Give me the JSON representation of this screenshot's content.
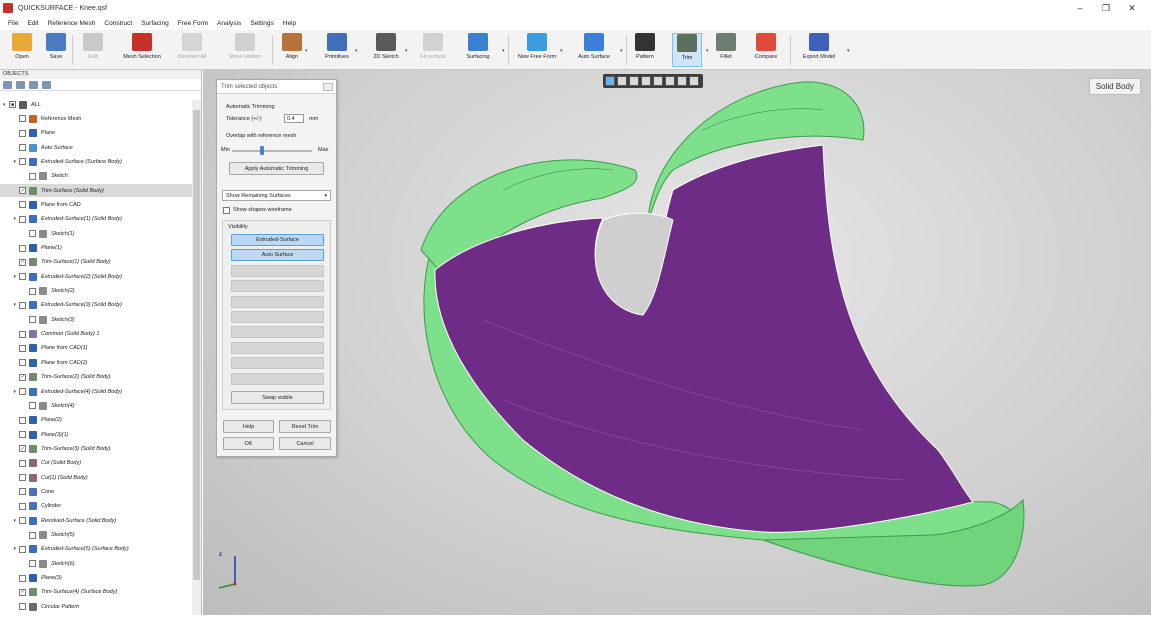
{
  "window": {
    "title": "QUICKSURFACE - Knee.qsf",
    "minimize": "–",
    "maximize": "❐",
    "close": "✕"
  },
  "menu": [
    "File",
    "Edit",
    "Reference Mesh",
    "Construct",
    "Surfacing",
    "Free Form",
    "Analysis",
    "Settings",
    "Help"
  ],
  "toolbar": [
    {
      "label": "Open",
      "icon": "folder-icon",
      "color": "#e8a83a"
    },
    {
      "label": "Save",
      "icon": "save-icon",
      "color": "#4a7cc1"
    },
    {
      "label": "Edit",
      "icon": "edit-icon",
      "color": "#c9c9c9"
    },
    {
      "label": "Mesh Selection",
      "icon": "mesh-selection-icon",
      "color": "#c8302a"
    },
    {
      "label": "Deselect All",
      "icon": "deselect-icon",
      "color": "#d5d5d5"
    },
    {
      "label": "Show Hidden",
      "icon": "eye-icon",
      "color": "#d0d0d0"
    },
    {
      "label": "Align",
      "icon": "align-icon",
      "color": "#b8733a"
    },
    {
      "label": "Primitives",
      "icon": "primitives-icon",
      "color": "#3f6fb8"
    },
    {
      "label": "2D Sketch",
      "icon": "sketch-icon",
      "color": "#5a5a5a"
    },
    {
      "label": "Fit surface",
      "icon": "fit-surface-icon",
      "color": "#d2d2d2"
    },
    {
      "label": "Surfacing",
      "icon": "surfacing-icon",
      "color": "#3b7fd0"
    },
    {
      "label": "New Free Form",
      "icon": "free-form-icon",
      "color": "#3d9be0"
    },
    {
      "label": "Auto Surface",
      "icon": "auto-surface-icon",
      "color": "#3d7fd8"
    },
    {
      "label": "Pattern",
      "icon": "gear-icon",
      "color": "#333333"
    },
    {
      "label": "Trim",
      "icon": "trim-icon",
      "color": "#5f6f5f"
    },
    {
      "label": "Fillet",
      "icon": "fillet-icon",
      "color": "#6d7d6d"
    },
    {
      "label": "Compare",
      "icon": "compare-icon",
      "color": "#e04a3a"
    },
    {
      "label": "Export Model",
      "icon": "export-icon",
      "color": "#3f5fb8"
    }
  ],
  "tree": {
    "title": "OBJECTS",
    "items": [
      {
        "label": "ALL",
        "icon": "all-icon",
        "indent": 0,
        "italic": false,
        "twisty": "▾",
        "checked": "■"
      },
      {
        "label": "Reference Mesh",
        "icon": "mesh-icon",
        "indent": 1,
        "italic": false,
        "twisty": "",
        "checked": ""
      },
      {
        "label": "Plane",
        "icon": "plane-icon",
        "indent": 1,
        "italic": false,
        "twisty": "",
        "checked": ""
      },
      {
        "label": "Auto Surface",
        "icon": "auto-surface-icon",
        "indent": 1,
        "italic": false,
        "twisty": "",
        "checked": ""
      },
      {
        "label": "Extruded-Surface (Surface Body)",
        "icon": "extrude-icon",
        "indent": 1,
        "italic": true,
        "twisty": "▾",
        "checked": ""
      },
      {
        "label": "Sketch",
        "icon": "sketch-icon",
        "indent": 2,
        "italic": true,
        "twisty": "",
        "checked": ""
      },
      {
        "label": "Trim-Surface (Solid Body)",
        "icon": "trim-icon",
        "indent": 1,
        "italic": true,
        "twisty": "",
        "checked": "✓",
        "selected": true
      },
      {
        "label": "Plane from CAD",
        "icon": "plane-icon",
        "indent": 1,
        "italic": false,
        "twisty": "",
        "checked": ""
      },
      {
        "label": "Extruded-Surface(1) (Solid Body)",
        "icon": "extrude-icon",
        "indent": 1,
        "italic": true,
        "twisty": "▾",
        "checked": ""
      },
      {
        "label": "Sketch(1)",
        "icon": "sketch-icon",
        "indent": 2,
        "italic": true,
        "twisty": "",
        "checked": ""
      },
      {
        "label": "Plane(1)",
        "icon": "plane-icon",
        "indent": 1,
        "italic": true,
        "twisty": "",
        "checked": ""
      },
      {
        "label": "Trim-Surface(1) (Solid Body)",
        "icon": "trim-icon",
        "indent": 1,
        "italic": true,
        "twisty": "",
        "checked": "✓"
      },
      {
        "label": "Extruded-Surface(2) (Solid Body)",
        "icon": "extrude-icon",
        "indent": 1,
        "italic": true,
        "twisty": "▾",
        "checked": ""
      },
      {
        "label": "Sketch(2)",
        "icon": "sketch-icon",
        "indent": 2,
        "italic": true,
        "twisty": "",
        "checked": ""
      },
      {
        "label": "Extruded-Surface(3) (Solid Body)",
        "icon": "extrude-icon",
        "indent": 1,
        "italic": true,
        "twisty": "▾",
        "checked": ""
      },
      {
        "label": "Sketch(3)",
        "icon": "sketch-icon",
        "indent": 2,
        "italic": true,
        "twisty": "",
        "checked": ""
      },
      {
        "label": "Common (Solid Body) 1",
        "icon": "common-icon",
        "indent": 1,
        "italic": true,
        "twisty": "",
        "checked": ""
      },
      {
        "label": "Plane from CAD(1)",
        "icon": "plane-icon",
        "indent": 1,
        "italic": true,
        "twisty": "",
        "checked": ""
      },
      {
        "label": "Plane from CAD(2)",
        "icon": "plane-icon",
        "indent": 1,
        "italic": true,
        "twisty": "",
        "checked": ""
      },
      {
        "label": "Trim-Surface(2) (Solid Body)",
        "icon": "trim-icon",
        "indent": 1,
        "italic": true,
        "twisty": "",
        "checked": "✓"
      },
      {
        "label": "Extruded-Surface(4) (Solid Body)",
        "icon": "extrude-icon",
        "indent": 1,
        "italic": true,
        "twisty": "▾",
        "checked": ""
      },
      {
        "label": "Sketch(4)",
        "icon": "sketch-icon",
        "indent": 2,
        "italic": true,
        "twisty": "",
        "checked": ""
      },
      {
        "label": "Plane(2)",
        "icon": "plane-icon",
        "indent": 1,
        "italic": true,
        "twisty": "",
        "checked": ""
      },
      {
        "label": "Plane(3)(1)",
        "icon": "plane-icon",
        "indent": 1,
        "italic": true,
        "twisty": "",
        "checked": ""
      },
      {
        "label": "Trim-Surface(3) (Solid Body)",
        "icon": "trim-icon",
        "indent": 1,
        "italic": true,
        "twisty": "",
        "checked": "✓"
      },
      {
        "label": "Cut (Solid Body)",
        "icon": "cut-icon",
        "indent": 1,
        "italic": true,
        "twisty": "",
        "checked": ""
      },
      {
        "label": "Cut(1) (Solid Body)",
        "icon": "cut-icon",
        "indent": 1,
        "italic": true,
        "twisty": "",
        "checked": ""
      },
      {
        "label": "Cone",
        "icon": "cone-icon",
        "indent": 1,
        "italic": false,
        "twisty": "",
        "checked": ""
      },
      {
        "label": "Cylinder",
        "icon": "cylinder-icon",
        "indent": 1,
        "italic": false,
        "twisty": "",
        "checked": ""
      },
      {
        "label": "Revolved-Surface (Solid Body)",
        "icon": "revolve-icon",
        "indent": 1,
        "italic": true,
        "twisty": "▾",
        "checked": ""
      },
      {
        "label": "Sketch(5)",
        "icon": "sketch-icon",
        "indent": 2,
        "italic": true,
        "twisty": "",
        "checked": ""
      },
      {
        "label": "Extruded-Surface(5) (Surface Body)",
        "icon": "extrude-icon",
        "indent": 1,
        "italic": true,
        "twisty": "▾",
        "checked": ""
      },
      {
        "label": "Sketch(6)",
        "icon": "sketch-icon",
        "indent": 2,
        "italic": true,
        "twisty": "",
        "checked": ""
      },
      {
        "label": "Plane(3)",
        "icon": "plane-icon",
        "indent": 1,
        "italic": true,
        "twisty": "",
        "checked": ""
      },
      {
        "label": "Trim-Surface(4) (Surface Body)",
        "icon": "trim-icon",
        "indent": 1,
        "italic": true,
        "twisty": "",
        "checked": "✓"
      },
      {
        "label": "Circular Pattern",
        "icon": "pattern-icon",
        "indent": 1,
        "italic": true,
        "twisty": "",
        "checked": ""
      }
    ]
  },
  "dialog": {
    "title": "Trim selected objects",
    "section": "Automatic Trimming",
    "tolerance_label": "Tolerance (+/-)",
    "tolerance_value": "0.4",
    "tolerance_unit": "mm",
    "overlap_label": "Overlap with reference mesh",
    "slider_min": "Min",
    "slider_max": "Max",
    "slider_level": 0.38,
    "apply_button": "Apply Automatic Trimming",
    "mode_select": "Show Remaining Surfaces",
    "wireframe_label": "Show shapes wireframe",
    "visibility_label": "Visibility",
    "visibility_items": [
      {
        "label": "Extruded-Surface",
        "state": "on"
      },
      {
        "label": "Auto Surface",
        "state": "on"
      },
      {
        "label": "",
        "state": "off"
      },
      {
        "label": "",
        "state": "off"
      },
      {
        "label": "",
        "state": "off"
      },
      {
        "label": "",
        "state": "off"
      },
      {
        "label": "",
        "state": "off"
      },
      {
        "label": "",
        "state": "off"
      },
      {
        "label": "",
        "state": "off"
      },
      {
        "label": "",
        "state": "off"
      }
    ],
    "swap_button": "Swap visible",
    "help_button": "Help",
    "reset_button": "Reset Trim",
    "ok_button": "OK",
    "cancel_button": "Cancel"
  },
  "viewport": {
    "badge": "Solid Body",
    "axis_z": "z",
    "colors": {
      "green_rim": "#7ee08a",
      "purple_face": "#6e2c86"
    }
  }
}
